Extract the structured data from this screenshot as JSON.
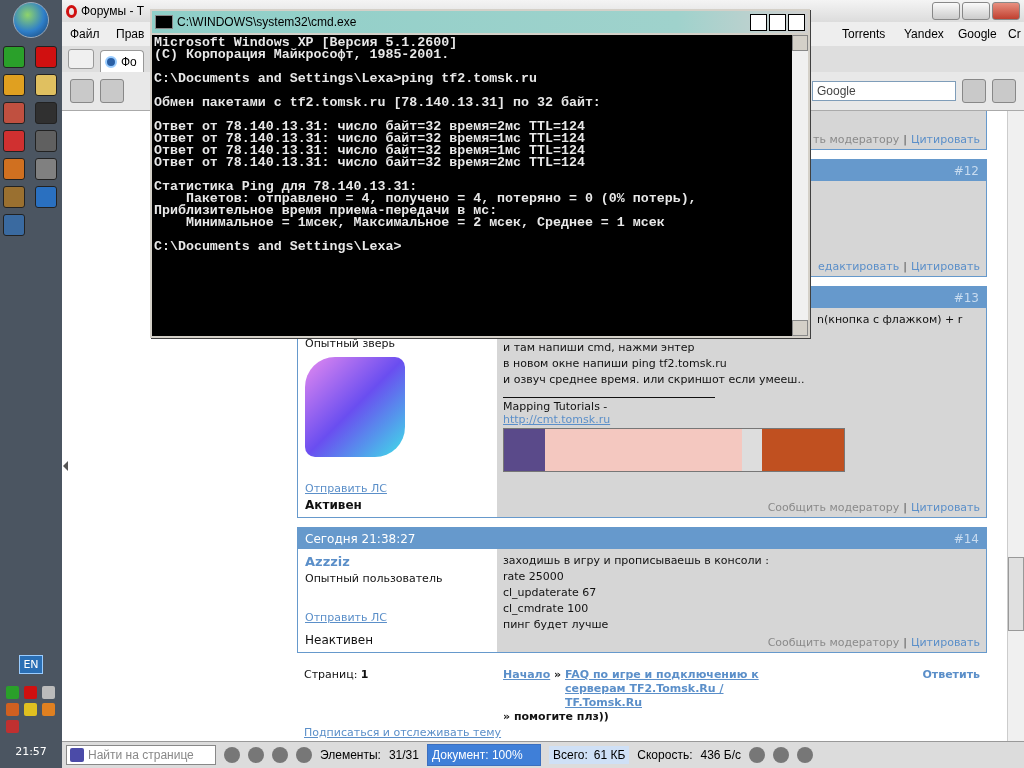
{
  "taskbar": {
    "language": "EN",
    "clock": "21:57"
  },
  "browser": {
    "title": "Форумы - T",
    "menu": [
      "Файл",
      "Прав",
      "Torrents",
      "Yandex",
      "Google",
      "Cr"
    ],
    "tab": "Фо",
    "search_value": "Google"
  },
  "forum": {
    "posts": [
      {
        "separator": "|",
        "footer": [
          {
            "label": "ть модератору",
            "kind": "muted"
          },
          {
            "label": "Цитировать",
            "kind": "link"
          }
        ]
      },
      {
        "number": "#12",
        "separator": "|",
        "footer": [
          {
            "label": "едактировать",
            "kind": "link"
          },
          {
            "label": "Цитировать",
            "kind": "link"
          }
        ]
      },
      {
        "number": "#13",
        "separator": "|",
        "author": {
          "rank": "Опытный зверь",
          "pm": "Отправить ЛС",
          "status": "Активен",
          "online": true
        },
        "lines": [
          {
            "text": "n(кнопка с флажком) + r",
            "kind": "partial"
          },
          {
            "text": "и там напиши cmd, нажми энтер",
            "kind": "line"
          },
          {
            "text": "в новом окне напиши ping tf2.tomsk.ru",
            "kind": "line"
          },
          {
            "text": "и озвуч среднее время. или скриншот если умееш..",
            "kind": "line"
          }
        ],
        "signature": {
          "text": "Mapping Tutorials - ",
          "link": "http://cmt.tomsk.ru"
        },
        "footer": [
          {
            "label": "Сообщить модератору",
            "kind": "muted"
          },
          {
            "label": "Цитировать",
            "kind": "link"
          }
        ]
      },
      {
        "date": "Сегодня 21:38:27",
        "number": "#14",
        "separator": "|",
        "author": {
          "name": "Azzziz",
          "rank": "Опытный пользователь",
          "pm": "Отправить ЛС",
          "status": "Неактивен",
          "online": false
        },
        "lines": [
          {
            "text": "заходишь в игру и прописываешь в консоли :",
            "kind": "line"
          },
          {
            "text": "rate 25000",
            "kind": "line"
          },
          {
            "text": "cl_updaterate 67",
            "kind": "line"
          },
          {
            "text": "cl_cmdrate 100",
            "kind": "line"
          },
          {
            "text": "пинг будет лучше",
            "kind": "line"
          }
        ],
        "footer": [
          {
            "label": "Сообщить модератору",
            "kind": "muted"
          },
          {
            "label": "Цитировать",
            "kind": "link"
          }
        ]
      }
    ],
    "pages": {
      "label": "Страниц:",
      "value": "1"
    },
    "breadcrumb": {
      "home": "Начало",
      "separator": "»",
      "section": "FAQ по игре и подключению к серверам TF2.Tomsk.Ru / TF.Tomsk.Ru",
      "topic": "помогите плз))"
    },
    "reply": "Ответить",
    "subscribe": "Подписаться и отслеживать тему"
  },
  "status_bar": {
    "find_placeholder": "Найти на странице",
    "elements_label": "Элементы:",
    "elements": "31/31",
    "document": {
      "label": "Документ:",
      "value": "100%",
      "level": 1
    },
    "total_label": "Всего:",
    "total": "61 КБ",
    "speed_label": "Скорость:",
    "speed": "436 Б/с"
  },
  "console": {
    "title": "C:\\WINDOWS\\system32\\cmd.exe",
    "blocks": [
      [
        "Microsoft Windows XP [Версия 5.1.2600]",
        "(C) Корпорация Майкрософт, 1985-2001."
      ],
      [
        "C:\\Documents and Settings\\Lexa>ping tf2.tomsk.ru"
      ],
      [
        "Обмен пакетами с tf2.tomsk.ru [78.140.13.31] по 32 байт:"
      ],
      [
        "Ответ от 78.140.13.31: число байт=32 время=2мс TTL=124",
        "Ответ от 78.140.13.31: число байт=32 время=1мс TTL=124",
        "Ответ от 78.140.13.31: число байт=32 время=1мс TTL=124",
        "Ответ от 78.140.13.31: число байт=32 время=2мс TTL=124"
      ],
      [
        "Статистика Ping для 78.140.13.31:",
        "    Пакетов: отправлено = 4, получено = 4, потеряно = 0 (0% потерь),",
        "Приблизительное время приема-передачи в мс:",
        "    Минимальное = 1мсек, Максимальное = 2 мсек, Среднее = 1 мсек"
      ],
      [
        "C:\\Documents and Settings\\Lexa>"
      ]
    ]
  }
}
